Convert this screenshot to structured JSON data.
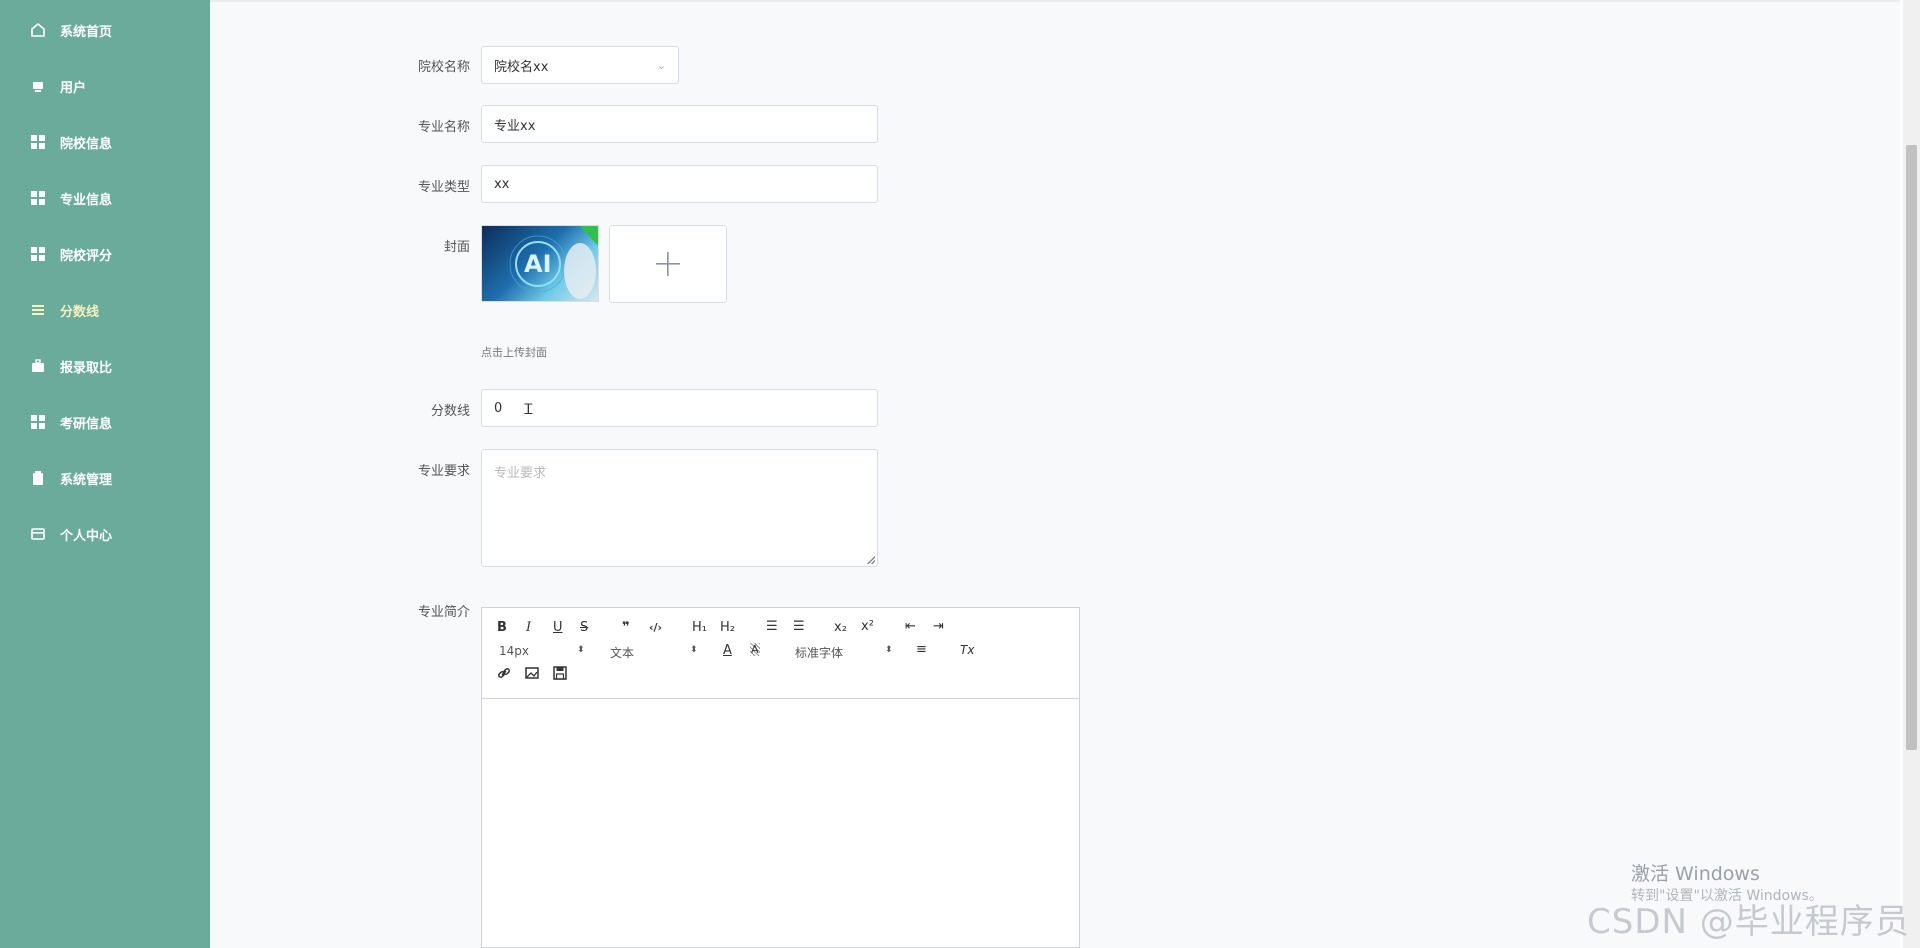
{
  "sidebar": {
    "items": [
      {
        "label": "系统首页"
      },
      {
        "label": "用户"
      },
      {
        "label": "院校信息"
      },
      {
        "label": "专业信息"
      },
      {
        "label": "院校评分"
      },
      {
        "label": "分数线"
      },
      {
        "label": "报录取比"
      },
      {
        "label": "考研信息"
      },
      {
        "label": "系统管理"
      },
      {
        "label": "个人中心"
      }
    ]
  },
  "form": {
    "school": {
      "label": "院校名称",
      "value": "院校名xx"
    },
    "major": {
      "label": "专业名称",
      "value": "专业xx"
    },
    "type": {
      "label": "专业类型",
      "value": "xx"
    },
    "cover": {
      "label": "封面",
      "hint": "点击上传封面",
      "image_text": "AI"
    },
    "score": {
      "label": "分数线",
      "value": "0"
    },
    "requirement": {
      "label": "专业要求",
      "placeholder": "专业要求"
    },
    "intro": {
      "label": "专业简介"
    }
  },
  "editor": {
    "bold": "B",
    "italic": "I",
    "underline": "U",
    "strike": "S",
    "quote": "❞",
    "code": "‹/›",
    "h1": "H₁",
    "h2": "H₂",
    "ol": "☰",
    "ul": "☰",
    "sub": "x₂",
    "sup": "x²",
    "outdent": "⇤",
    "indent": "⇥",
    "size": "14px",
    "header": "文本",
    "font_color": "A",
    "bg_color": "A",
    "font": "标准字体",
    "align": "≡",
    "clean": "Tx"
  },
  "watermark": {
    "line1": "激活 Windows",
    "line2": "转到\"设置\"以激活 Windows。",
    "line3": "CSDN @毕业程序员"
  }
}
